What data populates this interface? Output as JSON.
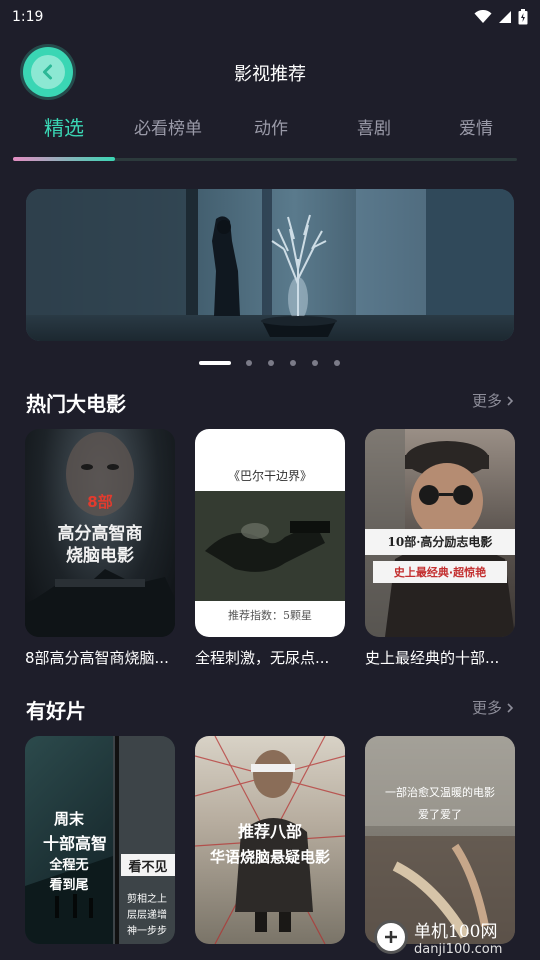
{
  "status": {
    "time": "1:19"
  },
  "header": {
    "title": "影视推荐"
  },
  "tabs": [
    {
      "label": "精选"
    },
    {
      "label": "必看榜单"
    },
    {
      "label": "动作"
    },
    {
      "label": "喜剧"
    },
    {
      "label": "爱情"
    }
  ],
  "banner": {
    "page_count": 6,
    "active_index": 0
  },
  "sections": [
    {
      "title": "热门大电影",
      "more": "更多",
      "cards": [
        {
          "title": "8部高分高智商烧脑...",
          "poster_lines": [
            "8部",
            "高分高智商",
            "烧脑电影"
          ]
        },
        {
          "title": "全程刺激，无尿点...",
          "poster_lines": [
            "《巴尔干边界》",
            "推荐指数：5颗星"
          ]
        },
        {
          "title": "史上最经典的十部...",
          "poster_lines": [
            "10部·高分励志电影",
            "史上最经典·超惊艳"
          ]
        }
      ]
    },
    {
      "title": "有好片",
      "more": "更多",
      "cards": [
        {
          "poster_lines": [
            "周末",
            "十部高智",
            "全程无",
            "看到尾",
            "看不见",
            "剪相之上",
            "层层递增",
            "神一步步"
          ]
        },
        {
          "poster_lines": [
            "推荐八部",
            "华语烧脑悬疑电影"
          ]
        },
        {
          "poster_lines": [
            "一部治愈又温暖的电影",
            "爱了爱了"
          ]
        }
      ]
    }
  ],
  "watermark": {
    "name": "单机100网",
    "url": "danji100.com"
  },
  "colors": {
    "accent": "#3ad6b4",
    "background": "#1e1e2a",
    "tab_inactive": "#9a9aa8"
  }
}
